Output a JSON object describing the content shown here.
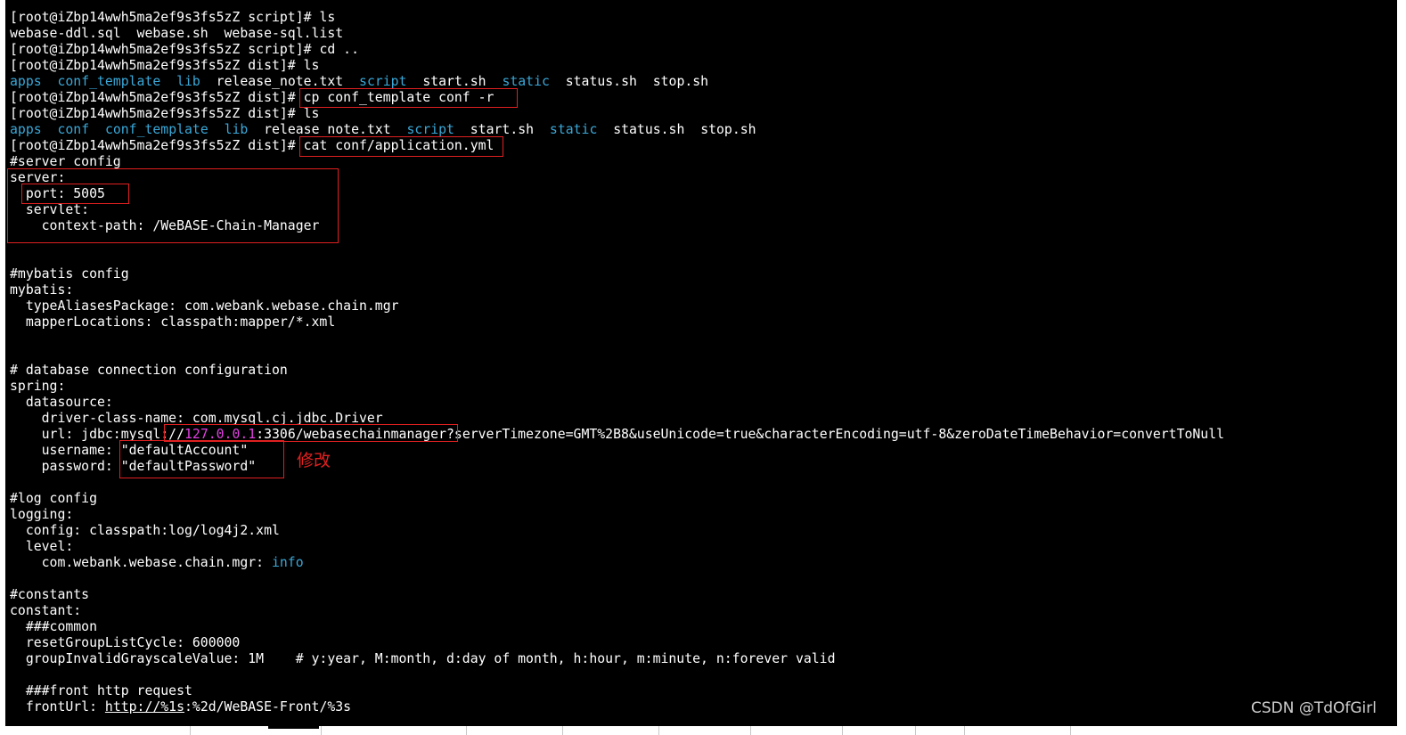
{
  "terminal": {
    "l01": {
      "prompt": "[root@iZbp14wwh5ma2ef9s3fs5zZ script]# ",
      "cmd": "ls"
    },
    "l02": {
      "text": "webase-ddl.sql  webase.sh  webase-sql.list"
    },
    "l03": {
      "prompt": "[root@iZbp14wwh5ma2ef9s3fs5zZ script]# ",
      "cmd": "cd .."
    },
    "l04": {
      "prompt": "[root@iZbp14wwh5ma2ef9s3fs5zZ dist]# ",
      "cmd": "ls"
    },
    "l05": {
      "apps": "apps",
      "conf_template": "conf_template",
      "lib": "lib",
      "release_note": "release_note.txt",
      "script": "script",
      "start": "start.sh",
      "static": "static",
      "status": "status.sh",
      "stop": "stop.sh"
    },
    "l06": {
      "prompt": "[root@iZbp14wwh5ma2ef9s3fs5zZ dist]# ",
      "cmd": "cp conf_template conf -r"
    },
    "l07": {
      "prompt": "[root@iZbp14wwh5ma2ef9s3fs5zZ dist]# ",
      "cmd": "ls"
    },
    "l08": {
      "apps": "apps",
      "conf": "conf",
      "conf_template": "conf_template",
      "lib": "lib",
      "release_note": "release_note.txt",
      "script": "script",
      "start": "start.sh",
      "static": "static",
      "status": "status.sh",
      "stop": "stop.sh"
    },
    "l09": {
      "prompt": "[root@iZbp14wwh5ma2ef9s3fs5zZ dist]# ",
      "cmd": "cat conf/application.yml"
    },
    "l10": {
      "text": "#server config"
    },
    "l11": {
      "text": "server:"
    },
    "l12": {
      "text": "  port: 5005"
    },
    "l13": {
      "text": "  servlet:"
    },
    "l14": {
      "text": "    context-path: /WeBASE-Chain-Manager"
    },
    "l17": {
      "text": "#mybatis config"
    },
    "l18": {
      "text": "mybatis:"
    },
    "l19": {
      "text": "  typeAliasesPackage: com.webank.webase.chain.mgr"
    },
    "l20": {
      "text": "  mapperLocations: classpath:mapper/*.xml"
    },
    "l23": {
      "text": "# database connection configuration"
    },
    "l24": {
      "text": "spring:"
    },
    "l25": {
      "text": "  datasource:"
    },
    "l26": {
      "text": "    driver-class-name: com.mysql.cj.jdbc.Driver"
    },
    "l27": {
      "a": "    url: jdbc:mysql:",
      "b": "//",
      "ip": "127.0.0.1",
      "c": ":3306/webasechainmanager?",
      "d": "serverTimezone=GMT%2B8&useUnicode=true&characterEncoding=utf-8&zeroDateTimeBehavior=convertToNull"
    },
    "l28": {
      "text": "    username: \"defaultAccount\""
    },
    "l29": {
      "text": "    password: \"defaultPassword\""
    },
    "l31": {
      "text": "#log config"
    },
    "l32": {
      "text": "logging:"
    },
    "l33": {
      "text": "  config: classpath:log/log4j2.xml"
    },
    "l34": {
      "text": "  level:"
    },
    "l35": {
      "key": "    com.webank.webase.chain.mgr: ",
      "val": "info"
    },
    "l37": {
      "text": "#constants"
    },
    "l38": {
      "text": "constant:"
    },
    "l39": {
      "text": "  ###common"
    },
    "l40": {
      "text": "  resetGroupListCycle: 600000"
    },
    "l41": {
      "text": "  groupInvalidGrayscaleValue: 1M    # y:year, M:month, d:day of month, h:hour, m:minute, n:forever valid"
    },
    "l43": {
      "text": "  ###front http request"
    },
    "l44": {
      "a": "  frontUrl: ",
      "link": "http://%1s",
      "b": ":%2d/WeBASE-Front/%3s"
    }
  },
  "annotation": {
    "note": "修改"
  },
  "watermark": {
    "text": "CSDN @TdOfGirl"
  },
  "colors": {
    "background": "#000000",
    "text": "#ffffff",
    "directory": "#3aa8d8",
    "ip": "#e040e0",
    "highlight": "#e02020"
  }
}
